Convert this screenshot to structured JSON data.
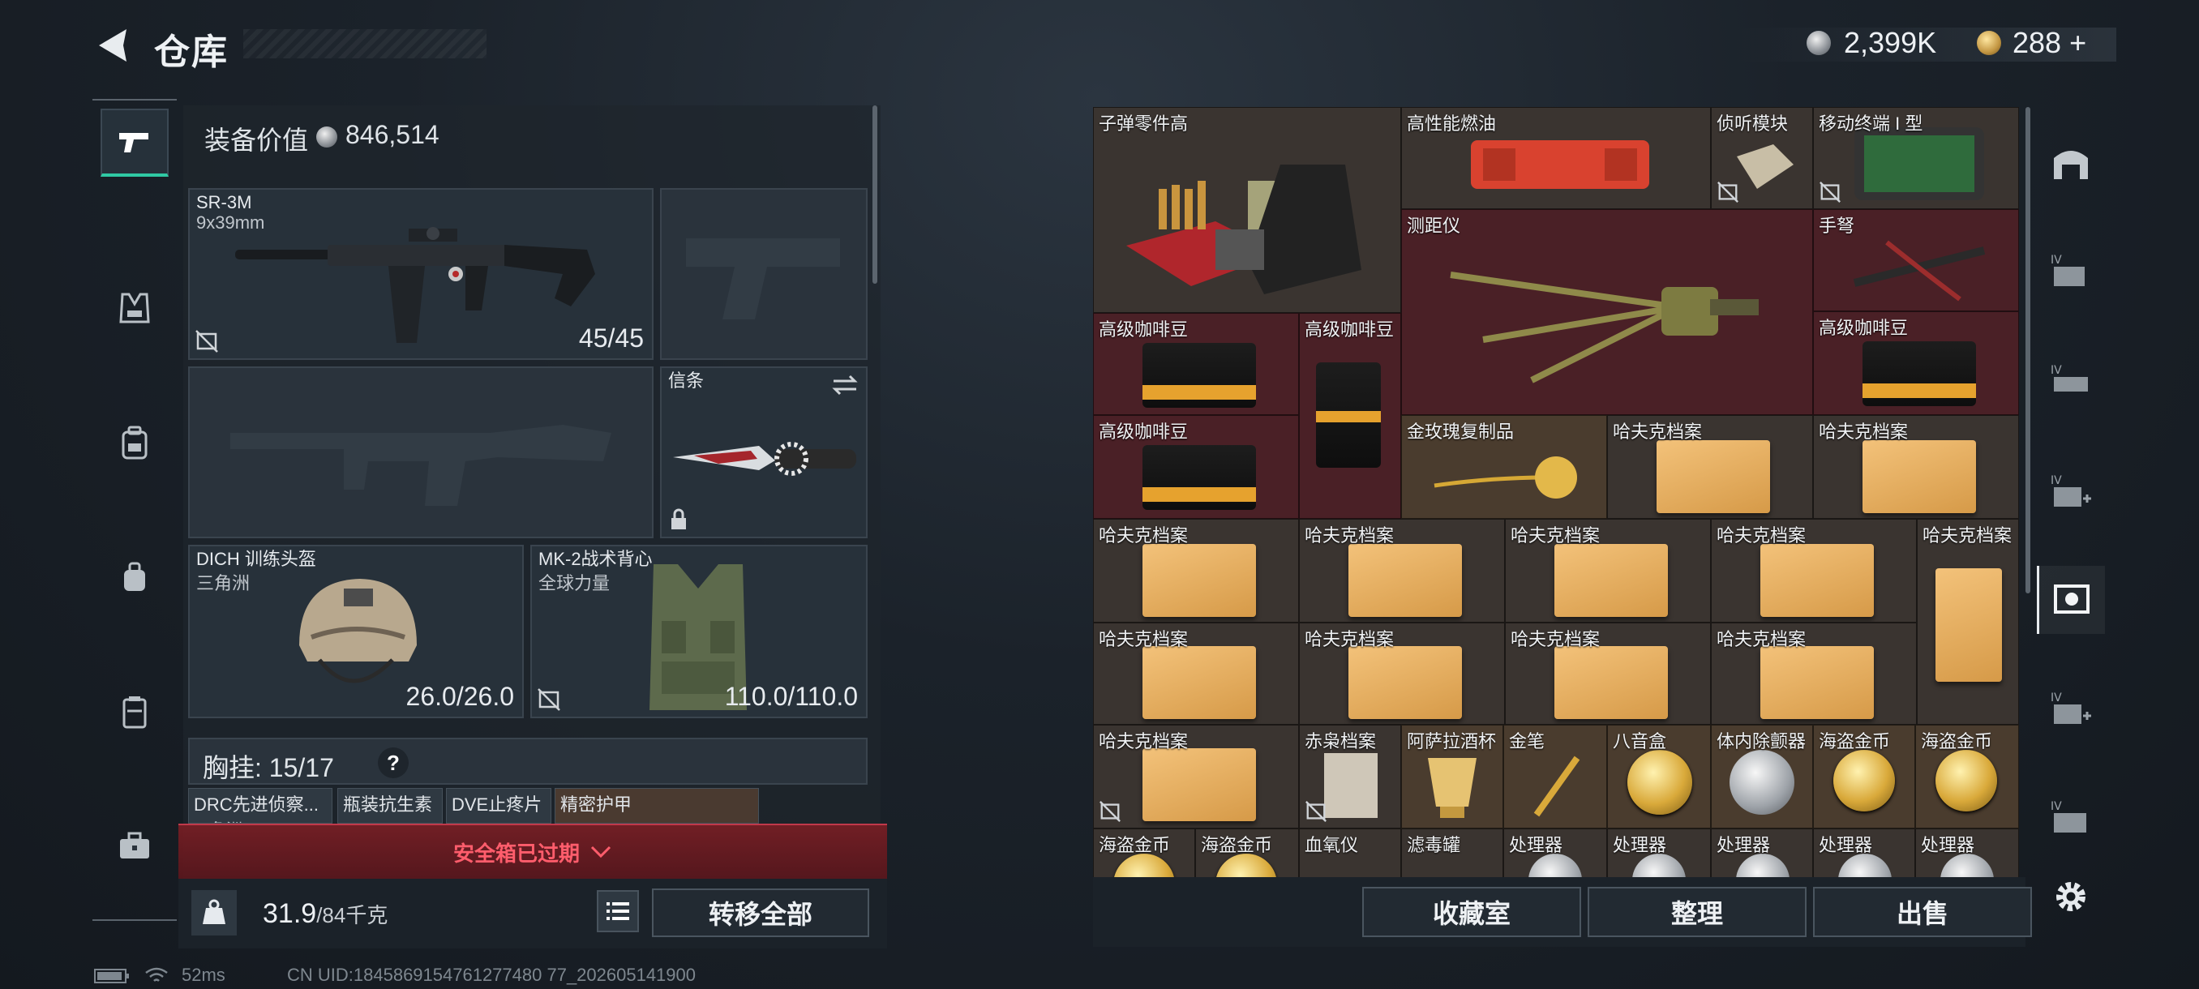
{
  "header": {
    "title": "仓库",
    "currency_silver": "2,399K",
    "currency_gold": "288",
    "gold_plus": "+"
  },
  "equipment": {
    "value_label": "装备价值",
    "value": "846,514",
    "primary": {
      "name": "SR-3M",
      "sub": "9x39mm",
      "ammo": "45/45"
    },
    "melee": {
      "name": "信条"
    },
    "helmet": {
      "name": "DICH 训练头盔",
      "sub": "三角洲",
      "durability": "26.0/26.0"
    },
    "armor": {
      "name": "MK-2战术背心",
      "sub": "全球力量",
      "durability": "110.0/110.0"
    },
    "chest_rig": {
      "label": "胸挂:",
      "count": "15/17",
      "help": "?"
    },
    "rig_items": [
      "DRC先进侦察...",
      "瓶装抗生素",
      "DVE止疼片",
      "精密护甲"
    ],
    "rig_item_sub": "三角洲"
  },
  "safe_box": {
    "text": "安全箱已过期"
  },
  "weight": {
    "current": "31.9",
    "max": "/84千克"
  },
  "buttons": {
    "transfer_all": "转移全部",
    "collection": "收藏室",
    "organize": "整理",
    "sell": "出售"
  },
  "stash": {
    "items": {
      "bullet_parts": "子弹零件高",
      "fuel": "高性能燃油",
      "listening": "侦听模块",
      "terminal": "移动终端 I 型",
      "rangefinder": "测距仪",
      "crossbow": "手弩",
      "coffee": "高级咖啡豆",
      "rose": "金玫瑰复制品",
      "hafk": "哈夫克档案",
      "chixiao": "赤枭档案",
      "arak": "阿萨拉酒杯",
      "pen": "金笔",
      "music_box": "八音盒",
      "detector": "体内除颤器",
      "pirate_coin": "海盗金币",
      "oximeter": "血氧仪",
      "filter": "滤毒罐",
      "processor": "处理器"
    }
  },
  "status": {
    "ping": "52ms",
    "uid": "CN UID:1845869154761277480 77_202605141900"
  },
  "colors": {
    "accent_green": "#2fc9a4",
    "warning_red": "#ff5d6c"
  }
}
